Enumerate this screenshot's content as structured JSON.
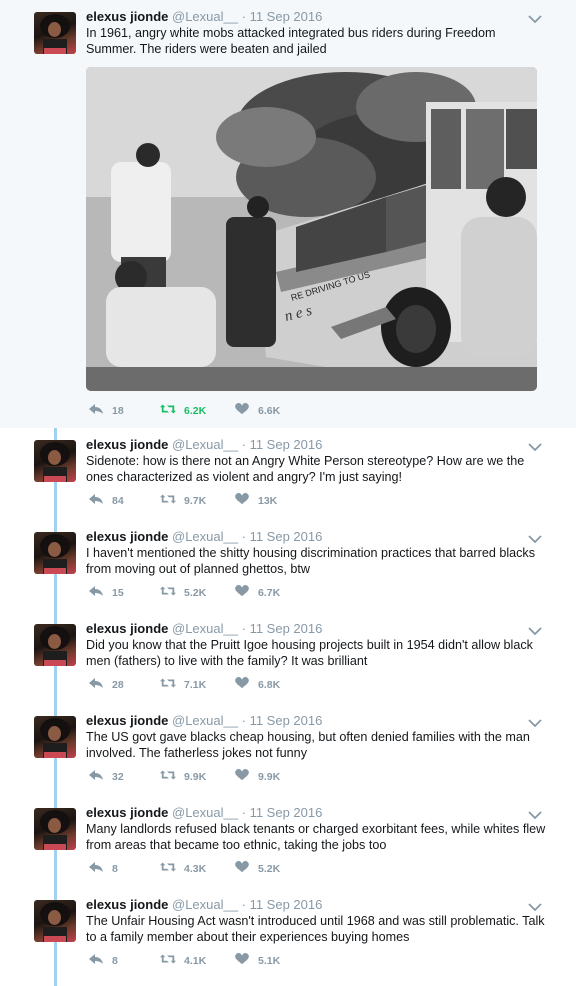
{
  "tweets": [
    {
      "name": "elexus jionde",
      "handle": "@Lexual__",
      "dot": "·",
      "date": "11 Sep 2016",
      "text": "In 1961, angry white mobs attacked integrated bus riders during Freedom Summer. The riders were beaten and jailed",
      "replies": "18",
      "retweets": "6.2K",
      "likes": "6.6K",
      "retweeted": true,
      "has_photo": true,
      "photo": {
        "bus_lettering": "RE DRIVING TO US",
        "bus_side_text": "n e s"
      }
    },
    {
      "name": "elexus jionde",
      "handle": "@Lexual__",
      "dot": "·",
      "date": "11 Sep 2016",
      "text": "Sidenote: how is there not an Angry White Person stereotype? How are we the ones characterized as violent and angry? I'm just saying!",
      "replies": "84",
      "retweets": "9.7K",
      "likes": "13K"
    },
    {
      "name": "elexus jionde",
      "handle": "@Lexual__",
      "dot": "·",
      "date": "11 Sep 2016",
      "text": "I haven't mentioned the shitty housing discrimination practices that barred blacks from moving out of planned ghettos, btw",
      "replies": "15",
      "retweets": "5.2K",
      "likes": "6.7K"
    },
    {
      "name": "elexus jionde",
      "handle": "@Lexual__",
      "dot": "·",
      "date": "11 Sep 2016",
      "text": "Did you know that the Pruitt Igoe housing projects built in 1954 didn't allow black men (fathers) to live with the family? It was brilliant",
      "replies": "28",
      "retweets": "7.1K",
      "likes": "6.8K"
    },
    {
      "name": "elexus jionde",
      "handle": "@Lexual__",
      "dot": "·",
      "date": "11 Sep 2016",
      "text": "The US govt gave blacks cheap housing, but often denied families with the man involved. The fatherless jokes not funny",
      "replies": "32",
      "retweets": "9.9K",
      "likes": "9.9K"
    },
    {
      "name": "elexus jionde",
      "handle": "@Lexual__",
      "dot": "·",
      "date": "11 Sep 2016",
      "text": "Many landlords refused black tenants or charged exorbitant fees, while whites flew from areas that became too ethnic, taking the jobs too",
      "replies": "8",
      "retweets": "4.3K",
      "likes": "5.2K"
    },
    {
      "name": "elexus jionde",
      "handle": "@Lexual__",
      "dot": "·",
      "date": "11 Sep 2016",
      "text": "The Unfair Housing Act wasn't introduced until 1968 and was still problematic. Talk to a family member about their experiences buying homes",
      "replies": "8",
      "retweets": "4.1K",
      "likes": "5.1K"
    }
  ],
  "icons": {
    "reply": "reply-icon",
    "retweet": "retweet-icon",
    "like": "heart-icon",
    "menu": "chevron-down-icon"
  },
  "colors": {
    "retweet_active": "#17bf63",
    "thread_line": "#a0d2f0",
    "meta_gray": "#8899a6"
  }
}
